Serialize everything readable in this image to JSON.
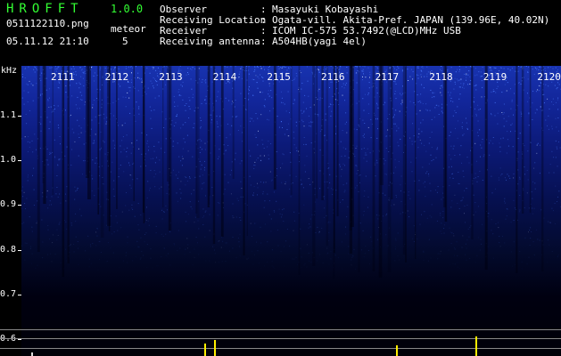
{
  "header": {
    "app_name": "HROFFT",
    "app_version": "1.0.0",
    "filename": "0511122110.png",
    "datetime": "05.11.12 21:10",
    "meteor_label": "meteor",
    "meteor_count": "5",
    "observer_label": "Observer",
    "observer_value": "Masayuki Kobayashi",
    "location_label": "Receiving Location",
    "location_value": "Ogata-vill. Akita-Pref. JAPAN (139.96E, 40.02N)",
    "receiver_label": "Receiver",
    "receiver_value": "ICOM IC-575 53.7492(@LCD)MHz USB",
    "antenna_label": "Receiving antenna",
    "antenna_value": "A504HB(yagi 4el)",
    "colon": ":"
  },
  "spectrogram": {
    "unit_label": "kHz",
    "y_ticks": [
      "1.1",
      "1.0",
      "0.9",
      "0.8",
      "0.7",
      "0.6"
    ],
    "x_ticks": [
      "2111",
      "2112",
      "2113",
      "2114",
      "2115",
      "2116",
      "2117",
      "2118",
      "2119",
      "2120"
    ],
    "colors": {
      "signal": "#4a7bff",
      "noise_bg": "#1833b0",
      "spike": "#ffee00",
      "axis_text": "#ffffff",
      "title": "#33ff33"
    }
  }
}
